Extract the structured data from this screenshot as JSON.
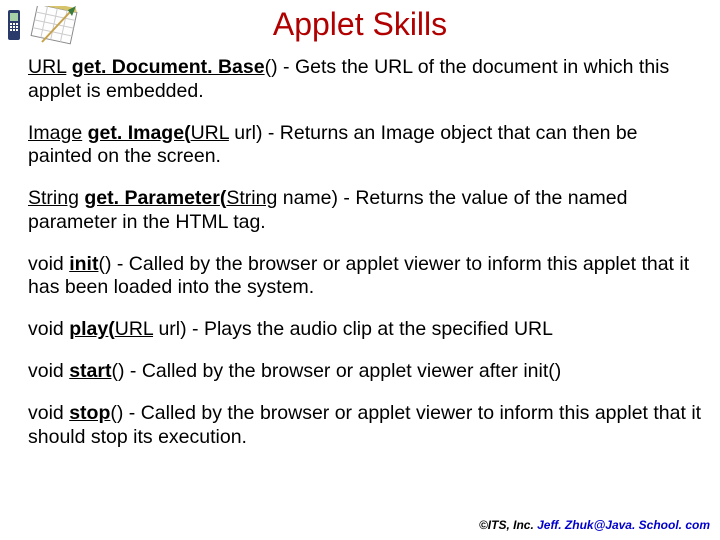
{
  "title": "Applet Skills",
  "items": [
    {
      "ret": "URL",
      "retU": true,
      "name": "get. Document. Base",
      "params": "()",
      "rest": " - Gets the URL of the document in which this applet is embedded.",
      "prefix": " "
    },
    {
      "ret": "Image",
      "retU": true,
      "name": "get. Image",
      "pOpen": "(",
      "pType": "URL",
      "pRest": " url)",
      "rest": " - Returns an Image object that can then be painted on the screen."
    },
    {
      "ret": "String",
      "retU": true,
      "name": "get. Parameter",
      "pOpen": "(",
      "pType": "String",
      "pRest": " name)",
      "rest": " - Returns the value of the named parameter in the HTML tag."
    },
    {
      "ret": "void",
      "retU": false,
      "name": "init",
      "params": "()",
      "rest": " - Called by the browser or applet viewer to inform this applet that it has been loaded into the system."
    },
    {
      "ret": "void",
      "retU": false,
      "name": "play",
      "pOpen": "(",
      "pType": "URL",
      "pRest": " url)",
      "rest": " - Plays the audio clip at the specified URL"
    },
    {
      "ret": "void",
      "retU": false,
      "name": "start",
      "params": "()",
      "rest": " - Called by the browser or applet viewer after init()"
    },
    {
      "ret": "void",
      "retU": false,
      "name": "stop",
      "params": "()",
      "rest": " - Called by the browser or applet viewer to inform this applet that it should stop its execution."
    }
  ],
  "footer": {
    "copy": "©ITS, Inc. ",
    "email": "Jeff. Zhuk@Java. School. com"
  }
}
